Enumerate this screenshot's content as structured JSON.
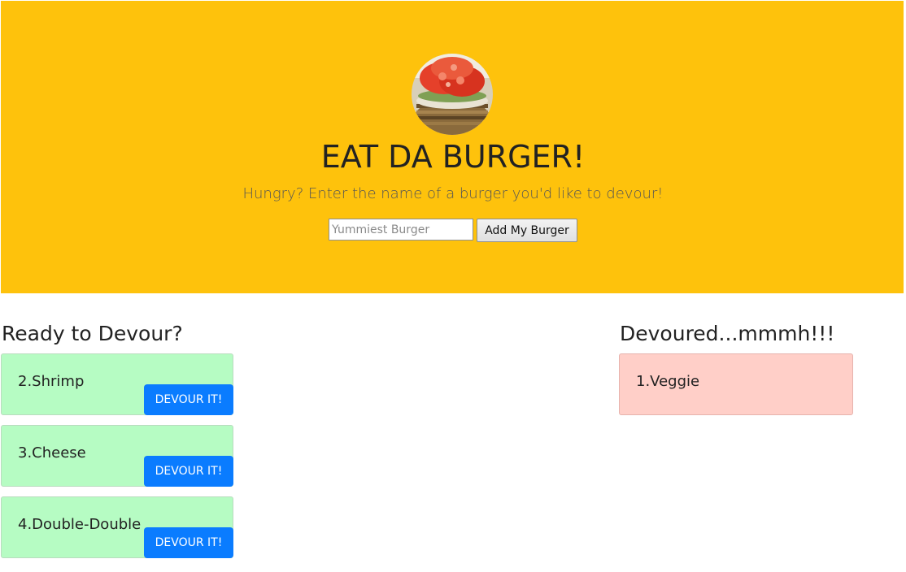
{
  "header": {
    "title": "EAT DA BURGER!",
    "subtitle": "Hungry? Enter the name of a burger you'd like to devour!",
    "input_placeholder": "Yummiest Burger",
    "input_value": "",
    "add_button_label": "Add My Burger",
    "logo_icon": "burger-image",
    "background_color": "#fec20c"
  },
  "ready": {
    "heading": "Ready to Devour?",
    "card_color": "#b6fcc3",
    "button_color": "#0a7cff",
    "items": [
      {
        "name": "2.Shrimp",
        "button_label": "DEVOUR IT!"
      },
      {
        "name": "3.Cheese",
        "button_label": "DEVOUR IT!"
      },
      {
        "name": "4.Double-Double",
        "button_label": "DEVOUR IT!"
      }
    ]
  },
  "devoured": {
    "heading": "Devoured...mmmh!!!",
    "card_color": "#ffcfc8",
    "items": [
      {
        "name": "1.Veggie"
      }
    ]
  }
}
